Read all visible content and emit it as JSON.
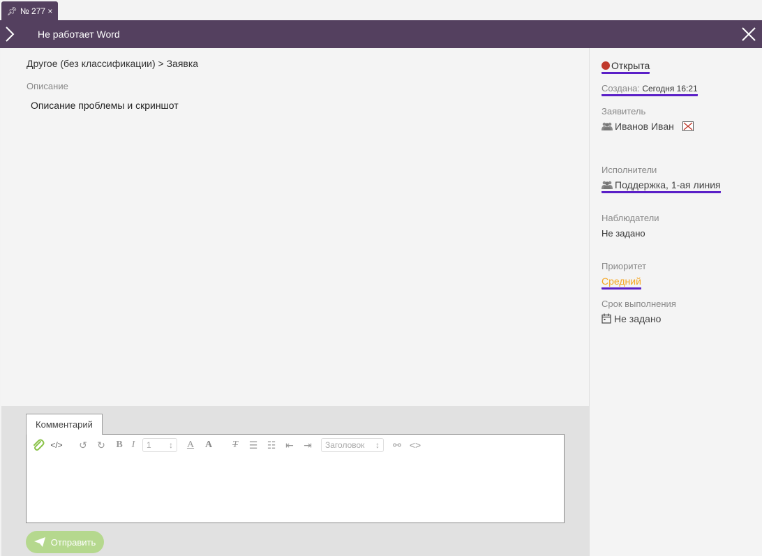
{
  "tab": {
    "label": "№ 277 ×"
  },
  "header": {
    "title": "Не работает Word"
  },
  "main": {
    "breadcrumb": "Другое (без классификации) >  Заявка",
    "description_label": "Описание",
    "description_text": "Описание проблемы и скриншот"
  },
  "sidebar": {
    "status": "Открыта",
    "created_label": "Создана:",
    "created_value": "Сегодня 16:21",
    "requester_label": "Заявитель",
    "requester_value": "Иванов Иван",
    "assignees_label": "Исполнители",
    "assignees_value": "Поддержка, 1-ая линия",
    "watchers_label": "Наблюдатели",
    "watchers_value": "Не задано",
    "priority_label": "Приоритет",
    "priority_value": "Средний",
    "deadline_label": "Срок выполнения",
    "deadline_value": "Не задано"
  },
  "comment": {
    "tab_label": "Комментарий",
    "font_size_value": "1",
    "heading_select": "Заголовок",
    "send_label": "Отправить"
  },
  "colors": {
    "header_bg": "#54405f",
    "underline": "#5a1fc7",
    "status_red": "#c0392b",
    "priority_orange": "#f5a623",
    "send_green": "#b5d88e"
  }
}
